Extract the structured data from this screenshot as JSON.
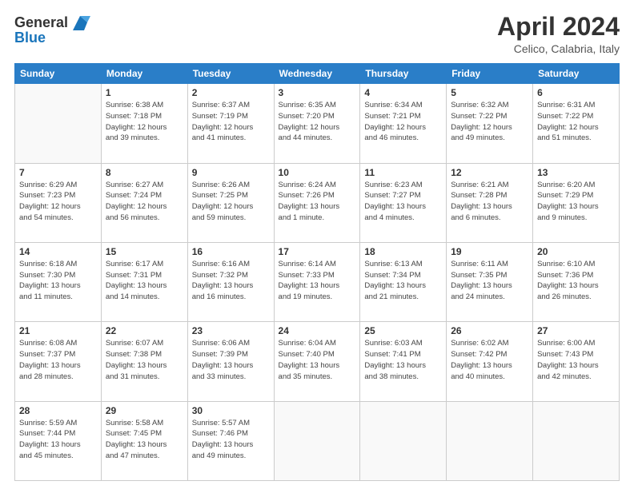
{
  "header": {
    "logo_line1": "General",
    "logo_line2": "Blue",
    "month": "April 2024",
    "location": "Celico, Calabria, Italy"
  },
  "weekdays": [
    "Sunday",
    "Monday",
    "Tuesday",
    "Wednesday",
    "Thursday",
    "Friday",
    "Saturday"
  ],
  "weeks": [
    [
      {
        "day": "",
        "empty": true
      },
      {
        "day": "1",
        "sunrise": "6:38 AM",
        "sunset": "7:18 PM",
        "daylight": "12 hours and 39 minutes."
      },
      {
        "day": "2",
        "sunrise": "6:37 AM",
        "sunset": "7:19 PM",
        "daylight": "12 hours and 41 minutes."
      },
      {
        "day": "3",
        "sunrise": "6:35 AM",
        "sunset": "7:20 PM",
        "daylight": "12 hours and 44 minutes."
      },
      {
        "day": "4",
        "sunrise": "6:34 AM",
        "sunset": "7:21 PM",
        "daylight": "12 hours and 46 minutes."
      },
      {
        "day": "5",
        "sunrise": "6:32 AM",
        "sunset": "7:22 PM",
        "daylight": "12 hours and 49 minutes."
      },
      {
        "day": "6",
        "sunrise": "6:31 AM",
        "sunset": "7:22 PM",
        "daylight": "12 hours and 51 minutes."
      }
    ],
    [
      {
        "day": "7",
        "sunrise": "6:29 AM",
        "sunset": "7:23 PM",
        "daylight": "12 hours and 54 minutes."
      },
      {
        "day": "8",
        "sunrise": "6:27 AM",
        "sunset": "7:24 PM",
        "daylight": "12 hours and 56 minutes."
      },
      {
        "day": "9",
        "sunrise": "6:26 AM",
        "sunset": "7:25 PM",
        "daylight": "12 hours and 59 minutes."
      },
      {
        "day": "10",
        "sunrise": "6:24 AM",
        "sunset": "7:26 PM",
        "daylight": "13 hours and 1 minute."
      },
      {
        "day": "11",
        "sunrise": "6:23 AM",
        "sunset": "7:27 PM",
        "daylight": "13 hours and 4 minutes."
      },
      {
        "day": "12",
        "sunrise": "6:21 AM",
        "sunset": "7:28 PM",
        "daylight": "13 hours and 6 minutes."
      },
      {
        "day": "13",
        "sunrise": "6:20 AM",
        "sunset": "7:29 PM",
        "daylight": "13 hours and 9 minutes."
      }
    ],
    [
      {
        "day": "14",
        "sunrise": "6:18 AM",
        "sunset": "7:30 PM",
        "daylight": "13 hours and 11 minutes."
      },
      {
        "day": "15",
        "sunrise": "6:17 AM",
        "sunset": "7:31 PM",
        "daylight": "13 hours and 14 minutes."
      },
      {
        "day": "16",
        "sunrise": "6:16 AM",
        "sunset": "7:32 PM",
        "daylight": "13 hours and 16 minutes."
      },
      {
        "day": "17",
        "sunrise": "6:14 AM",
        "sunset": "7:33 PM",
        "daylight": "13 hours and 19 minutes."
      },
      {
        "day": "18",
        "sunrise": "6:13 AM",
        "sunset": "7:34 PM",
        "daylight": "13 hours and 21 minutes."
      },
      {
        "day": "19",
        "sunrise": "6:11 AM",
        "sunset": "7:35 PM",
        "daylight": "13 hours and 24 minutes."
      },
      {
        "day": "20",
        "sunrise": "6:10 AM",
        "sunset": "7:36 PM",
        "daylight": "13 hours and 26 minutes."
      }
    ],
    [
      {
        "day": "21",
        "sunrise": "6:08 AM",
        "sunset": "7:37 PM",
        "daylight": "13 hours and 28 minutes."
      },
      {
        "day": "22",
        "sunrise": "6:07 AM",
        "sunset": "7:38 PM",
        "daylight": "13 hours and 31 minutes."
      },
      {
        "day": "23",
        "sunrise": "6:06 AM",
        "sunset": "7:39 PM",
        "daylight": "13 hours and 33 minutes."
      },
      {
        "day": "24",
        "sunrise": "6:04 AM",
        "sunset": "7:40 PM",
        "daylight": "13 hours and 35 minutes."
      },
      {
        "day": "25",
        "sunrise": "6:03 AM",
        "sunset": "7:41 PM",
        "daylight": "13 hours and 38 minutes."
      },
      {
        "day": "26",
        "sunrise": "6:02 AM",
        "sunset": "7:42 PM",
        "daylight": "13 hours and 40 minutes."
      },
      {
        "day": "27",
        "sunrise": "6:00 AM",
        "sunset": "7:43 PM",
        "daylight": "13 hours and 42 minutes."
      }
    ],
    [
      {
        "day": "28",
        "sunrise": "5:59 AM",
        "sunset": "7:44 PM",
        "daylight": "13 hours and 45 minutes."
      },
      {
        "day": "29",
        "sunrise": "5:58 AM",
        "sunset": "7:45 PM",
        "daylight": "13 hours and 47 minutes."
      },
      {
        "day": "30",
        "sunrise": "5:57 AM",
        "sunset": "7:46 PM",
        "daylight": "13 hours and 49 minutes."
      },
      {
        "day": "",
        "empty": true
      },
      {
        "day": "",
        "empty": true
      },
      {
        "day": "",
        "empty": true
      },
      {
        "day": "",
        "empty": true
      }
    ]
  ]
}
